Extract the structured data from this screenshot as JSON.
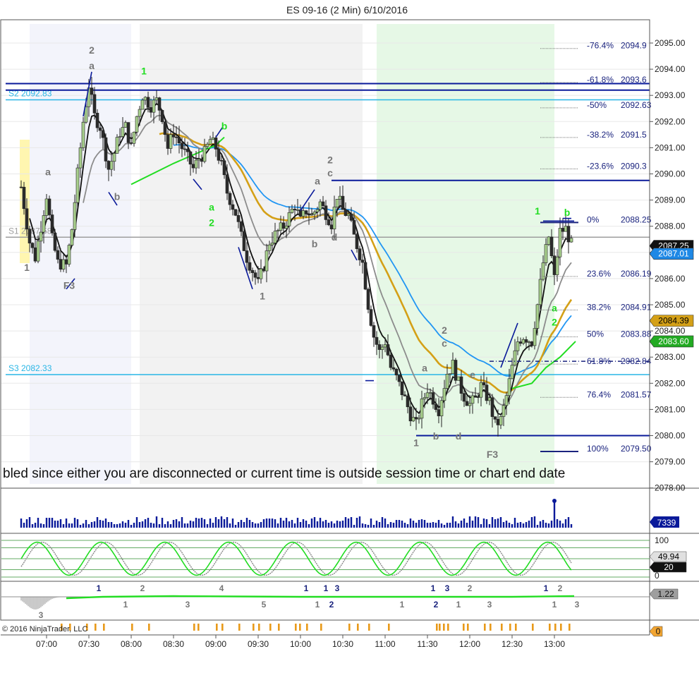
{
  "title": "ES 09-16 (2 Min)  6/10/2016",
  "banner": "bled since either you are disconnected or current time is outside session time or chart end date",
  "copyright": "© 2016 NinjaTrader, LLC",
  "colors": {
    "up_candle": "#a8d08d",
    "down_candle": "#2b2b2b",
    "s_level": "#29b6e6",
    "swing": "#0a1a9a",
    "ema_black": "#111111",
    "ma_gray": "#8c8c8c",
    "ma_gold": "#d4a017",
    "ma_blue": "#2196f3",
    "green": "#22dd22",
    "fib": "#1a237e"
  },
  "chart_data": {
    "type": "candlestick",
    "title": "ES 09-16 (2 Min)  6/10/2016",
    "ylim": [
      2077.85,
      2095.7
    ],
    "y_ticks": [
      "2095.00",
      "2094.00",
      "2093.00",
      "2092.00",
      "2091.00",
      "2090.00",
      "2089.00",
      "2088.00",
      "2087.00",
      "2086.00",
      "2085.00",
      "2084.00",
      "2083.00",
      "2082.00",
      "2081.00",
      "2080.00",
      "2079.00",
      "2078.00"
    ],
    "x_time_range": [
      "06:41",
      "13:15"
    ],
    "x_ticks": [
      "07:00",
      "07:30",
      "08:00",
      "08:30",
      "09:00",
      "09:30",
      "10:00",
      "10:30",
      "11:00",
      "11:30",
      "12:00",
      "12:30",
      "13:00"
    ],
    "close_path": [
      {
        "t": "06:42",
        "y": 2089.5
      },
      {
        "t": "06:48",
        "y": 2087.4
      },
      {
        "t": "06:52",
        "y": 2086.8
      },
      {
        "t": "06:56",
        "y": 2088.0
      },
      {
        "t": "07:00",
        "y": 2089.2
      },
      {
        "t": "07:04",
        "y": 2087.5
      },
      {
        "t": "07:08",
        "y": 2086.6
      },
      {
        "t": "07:14",
        "y": 2086.5
      },
      {
        "t": "07:18",
        "y": 2087.9
      },
      {
        "t": "07:22",
        "y": 2090.0
      },
      {
        "t": "07:26",
        "y": 2092.0
      },
      {
        "t": "07:30",
        "y": 2093.4
      },
      {
        "t": "07:34",
        "y": 2092.2
      },
      {
        "t": "07:38",
        "y": 2091.8
      },
      {
        "t": "07:44",
        "y": 2090.2
      },
      {
        "t": "07:48",
        "y": 2090.8
      },
      {
        "t": "07:52",
        "y": 2091.6
      },
      {
        "t": "07:56",
        "y": 2091.8
      },
      {
        "t": "08:00",
        "y": 2091.0
      },
      {
        "t": "08:04",
        "y": 2092.2
      },
      {
        "t": "08:08",
        "y": 2093.0
      },
      {
        "t": "08:14",
        "y": 2092.6
      },
      {
        "t": "08:18",
        "y": 2092.8
      },
      {
        "t": "08:22",
        "y": 2092.2
      },
      {
        "t": "08:26",
        "y": 2091.0
      },
      {
        "t": "08:30",
        "y": 2091.6
      },
      {
        "t": "08:36",
        "y": 2091.0
      },
      {
        "t": "08:40",
        "y": 2090.6
      },
      {
        "t": "08:44",
        "y": 2090.2
      },
      {
        "t": "08:48",
        "y": 2090.6
      },
      {
        "t": "08:52",
        "y": 2090.8
      },
      {
        "t": "08:56",
        "y": 2091.3
      },
      {
        "t": "09:00",
        "y": 2091.0
      },
      {
        "t": "09:04",
        "y": 2090.3
      },
      {
        "t": "09:08",
        "y": 2089.3
      },
      {
        "t": "09:14",
        "y": 2088.5
      },
      {
        "t": "09:18",
        "y": 2087.6
      },
      {
        "t": "09:22",
        "y": 2086.8
      },
      {
        "t": "09:26",
        "y": 2086.3
      },
      {
        "t": "09:30",
        "y": 2085.8
      },
      {
        "t": "09:34",
        "y": 2086.5
      },
      {
        "t": "09:38",
        "y": 2087.4
      },
      {
        "t": "09:44",
        "y": 2087.8
      },
      {
        "t": "09:48",
        "y": 2088.0
      },
      {
        "t": "09:52",
        "y": 2088.4
      },
      {
        "t": "09:56",
        "y": 2088.8
      },
      {
        "t": "10:00",
        "y": 2088.2
      },
      {
        "t": "10:04",
        "y": 2088.6
      },
      {
        "t": "10:08",
        "y": 2088.4
      },
      {
        "t": "10:14",
        "y": 2088.9
      },
      {
        "t": "10:18",
        "y": 2088.5
      },
      {
        "t": "10:22",
        "y": 2088.1
      },
      {
        "t": "10:26",
        "y": 2089.2
      },
      {
        "t": "10:30",
        "y": 2088.6
      },
      {
        "t": "10:34",
        "y": 2088.4
      },
      {
        "t": "10:38",
        "y": 2087.6
      },
      {
        "t": "10:44",
        "y": 2086.6
      },
      {
        "t": "10:48",
        "y": 2085.0
      },
      {
        "t": "10:52",
        "y": 2083.8
      },
      {
        "t": "10:56",
        "y": 2083.2
      },
      {
        "t": "11:00",
        "y": 2083.6
      },
      {
        "t": "11:04",
        "y": 2082.6
      },
      {
        "t": "11:08",
        "y": 2082.2
      },
      {
        "t": "11:14",
        "y": 2081.4
      },
      {
        "t": "11:18",
        "y": 2080.8
      },
      {
        "t": "11:22",
        "y": 2080.4
      },
      {
        "t": "11:26",
        "y": 2081.2
      },
      {
        "t": "11:30",
        "y": 2081.8
      },
      {
        "t": "11:34",
        "y": 2081.4
      },
      {
        "t": "11:38",
        "y": 2081.0
      },
      {
        "t": "11:44",
        "y": 2082.4
      },
      {
        "t": "11:48",
        "y": 2082.7
      },
      {
        "t": "11:52",
        "y": 2082.0
      },
      {
        "t": "11:56",
        "y": 2081.5
      },
      {
        "t": "12:00",
        "y": 2081.2
      },
      {
        "t": "12:04",
        "y": 2081.4
      },
      {
        "t": "12:08",
        "y": 2081.9
      },
      {
        "t": "12:14",
        "y": 2081.3
      },
      {
        "t": "12:18",
        "y": 2080.4
      },
      {
        "t": "12:22",
        "y": 2080.6
      },
      {
        "t": "12:26",
        "y": 2081.5
      },
      {
        "t": "12:30",
        "y": 2082.6
      },
      {
        "t": "12:34",
        "y": 2083.6
      },
      {
        "t": "12:38",
        "y": 2083.8
      },
      {
        "t": "12:44",
        "y": 2083.6
      },
      {
        "t": "12:48",
        "y": 2085.0
      },
      {
        "t": "12:52",
        "y": 2086.6
      },
      {
        "t": "12:56",
        "y": 2087.6
      },
      {
        "t": "13:00",
        "y": 2086.0
      },
      {
        "t": "13:04",
        "y": 2087.8
      },
      {
        "t": "13:08",
        "y": 2087.9
      },
      {
        "t": "13:12",
        "y": 2087.3
      }
    ],
    "sessions": [
      {
        "from": "06:41",
        "to": "06:48",
        "fill": "#fff6b0"
      },
      {
        "from": "06:48",
        "to": "08:00",
        "fill": "#f3f4fb"
      },
      {
        "from": "08:06",
        "to": "10:44",
        "fill": "#f2f2f2"
      },
      {
        "from": "10:54",
        "to": "13:00",
        "fill": "#e6f8e6"
      }
    ],
    "horizontal_levels": [
      {
        "name": "S2",
        "label": "S2 2092.83",
        "y": 2092.83,
        "color": "#29b6e6"
      },
      {
        "name": "S3",
        "label": "S3 2082.33",
        "y": 2082.33,
        "color": "#29b6e6"
      },
      {
        "name": "S1",
        "label": "S1 2087.58",
        "y": 2087.58,
        "color": "#9e9e9e"
      },
      {
        "name": "R1",
        "label": "",
        "y": 2093.45,
        "color": "#0a1a9a"
      },
      {
        "name": "R2",
        "label": "",
        "y": 2093.2,
        "color": "#0a1a9a"
      },
      {
        "name": "mid",
        "label": "",
        "y": 2089.75,
        "color": "#0a1a9a"
      },
      {
        "name": "low",
        "label": "",
        "y": 2080.0,
        "color": "#0a1a9a"
      }
    ],
    "fib_levels": [
      {
        "pct": "-76.4%",
        "value": "2094.9",
        "y": 2094.9
      },
      {
        "pct": "-61.8%",
        "value": "2093.6",
        "y": 2093.6
      },
      {
        "pct": "-50%",
        "value": "2092.63",
        "y": 2092.63
      },
      {
        "pct": "-38.2%",
        "value": "2091.5",
        "y": 2091.5
      },
      {
        "pct": "-23.6%",
        "value": "2090.3",
        "y": 2090.3
      },
      {
        "pct": "0%",
        "value": "2088.25",
        "y": 2088.25
      },
      {
        "pct": "23.6%",
        "value": "2086.19",
        "y": 2086.19
      },
      {
        "pct": "38.2%",
        "value": "2084.91",
        "y": 2084.91
      },
      {
        "pct": "50%",
        "value": "2083.88",
        "y": 2083.88
      },
      {
        "pct": "61.8%",
        "value": "2082.84",
        "y": 2082.84
      },
      {
        "pct": "76.4%",
        "value": "2081.57",
        "y": 2081.57
      },
      {
        "pct": "100%",
        "value": "2079.50",
        "y": 2079.5
      }
    ],
    "price_badges": [
      {
        "label": "2087.25",
        "y": 2087.25,
        "bg": "#111111",
        "fg": "#ffffff"
      },
      {
        "label": "2087.01",
        "y": 2086.95,
        "bg": "#1e88e5",
        "fg": "#ffffff"
      },
      {
        "label": "2084.39",
        "y": 2084.39,
        "bg": "#d4a017",
        "fg": "#000000"
      },
      {
        "label": "2083.60",
        "y": 2083.6,
        "bg": "#22aa22",
        "fg": "#ffffff"
      }
    ],
    "wave_labels": [
      {
        "text": "1",
        "t": "06:46",
        "y": 2086.3,
        "color": "#777777"
      },
      {
        "text": "a",
        "t": "07:01",
        "y": 2089.95,
        "color": "#777777"
      },
      {
        "text": "F3",
        "t": "07:16",
        "y": 2085.6,
        "color": "#777777"
      },
      {
        "text": "2",
        "t": "07:32",
        "y": 2094.6,
        "color": "#777777"
      },
      {
        "text": "a",
        "t": "07:32",
        "y": 2094.0,
        "color": "#777777"
      },
      {
        "text": "b",
        "t": "07:50",
        "y": 2089.0,
        "color": "#777777"
      },
      {
        "text": "1",
        "t": "08:09",
        "y": 2093.8,
        "color": "#22dd22"
      },
      {
        "text": "b",
        "t": "09:06",
        "y": 2091.7,
        "color": "#22dd22"
      },
      {
        "text": "a",
        "t": "08:57",
        "y": 2088.6,
        "color": "#22dd22"
      },
      {
        "text": "2",
        "t": "08:57",
        "y": 2088.0,
        "color": "#22dd22"
      },
      {
        "text": "1",
        "t": "09:33",
        "y": 2085.2,
        "color": "#777777"
      },
      {
        "text": "a",
        "t": "10:12",
        "y": 2089.6,
        "color": "#777777"
      },
      {
        "text": "b",
        "t": "10:10",
        "y": 2087.2,
        "color": "#777777"
      },
      {
        "text": "2",
        "t": "10:21",
        "y": 2090.4,
        "color": "#777777"
      },
      {
        "text": "c",
        "t": "10:21",
        "y": 2089.9,
        "color": "#777777"
      },
      {
        "text": "d",
        "t": "10:24",
        "y": 2087.45,
        "color": "#777777"
      },
      {
        "text": "1",
        "t": "11:22",
        "y": 2079.6,
        "color": "#777777"
      },
      {
        "text": "a",
        "t": "11:28",
        "y": 2082.45,
        "color": "#777777"
      },
      {
        "text": "b",
        "t": "11:36",
        "y": 2079.85,
        "color": "#777777"
      },
      {
        "text": "2",
        "t": "11:42",
        "y": 2083.9,
        "color": "#777777"
      },
      {
        "text": "c",
        "t": "11:42",
        "y": 2083.4,
        "color": "#777777"
      },
      {
        "text": "d",
        "t": "11:52",
        "y": 2079.85,
        "color": "#777777"
      },
      {
        "text": "e",
        "t": "12:02",
        "y": 2082.2,
        "color": "#777777"
      },
      {
        "text": "F3",
        "t": "12:16",
        "y": 2079.15,
        "color": "#777777"
      },
      {
        "text": "1",
        "t": "12:48",
        "y": 2088.45,
        "color": "#22dd22"
      },
      {
        "text": "b",
        "t": "13:09",
        "y": 2088.4,
        "color": "#22dd22"
      },
      {
        "text": "a",
        "t": "13:00",
        "y": 2084.75,
        "color": "#22dd22"
      },
      {
        "text": "2",
        "t": "13:00",
        "y": 2084.2,
        "color": "#22dd22"
      }
    ],
    "volume": {
      "badge": "7339",
      "spike_t": "13:00"
    },
    "stochastic": {
      "ticks": [
        "100",
        "0"
      ],
      "badges": [
        {
          "label": "49.94",
          "bg": "#e0e0e0",
          "fg": "#000000"
        },
        {
          "label": "20",
          "bg": "#111111",
          "fg": "#ffffff"
        }
      ]
    },
    "oscillator": {
      "badge": "1.22",
      "labels": [
        {
          "text": "3",
          "t": "06:56",
          "row": "low",
          "color": "#777777"
        },
        {
          "text": "1",
          "t": "07:37",
          "row": "top",
          "color": "#1a237e"
        },
        {
          "text": "1",
          "t": "07:56",
          "row": "mid",
          "color": "#777777"
        },
        {
          "text": "2",
          "t": "08:08",
          "row": "top",
          "color": "#777777"
        },
        {
          "text": "3",
          "t": "08:40",
          "row": "mid",
          "color": "#777777"
        },
        {
          "text": "4",
          "t": "09:04",
          "row": "top",
          "color": "#777777"
        },
        {
          "text": "5",
          "t": "09:34",
          "row": "mid",
          "color": "#777777"
        },
        {
          "text": "1",
          "t": "10:04",
          "row": "top",
          "color": "#1a237e"
        },
        {
          "text": "1",
          "t": "10:12",
          "row": "mid",
          "color": "#777777"
        },
        {
          "text": "1",
          "t": "10:18",
          "row": "top",
          "color": "#1a237e"
        },
        {
          "text": "3",
          "t": "10:26",
          "row": "top",
          "color": "#1a237e"
        },
        {
          "text": "2",
          "t": "10:22",
          "row": "mid",
          "color": "#1a237e"
        },
        {
          "text": "1",
          "t": "11:12",
          "row": "mid",
          "color": "#777777"
        },
        {
          "text": "1",
          "t": "11:34",
          "row": "top",
          "color": "#1a237e"
        },
        {
          "text": "3",
          "t": "11:44",
          "row": "top",
          "color": "#1a237e"
        },
        {
          "text": "2",
          "t": "11:36",
          "row": "mid",
          "color": "#1a237e"
        },
        {
          "text": "2",
          "t": "12:00",
          "row": "top",
          "color": "#777777"
        },
        {
          "text": "1",
          "t": "11:52",
          "row": "mid",
          "color": "#777777"
        },
        {
          "text": "3",
          "t": "12:14",
          "row": "mid",
          "color": "#777777"
        },
        {
          "text": "1",
          "t": "12:54",
          "row": "top",
          "color": "#1a237e"
        },
        {
          "text": "2",
          "t": "13:04",
          "row": "top",
          "color": "#777777"
        },
        {
          "text": "1",
          "t": "13:00",
          "row": "mid",
          "color": "#777777"
        },
        {
          "text": "3",
          "t": "13:16",
          "row": "mid",
          "color": "#777777"
        }
      ]
    },
    "bottom_strip": {
      "badge": "0"
    }
  }
}
